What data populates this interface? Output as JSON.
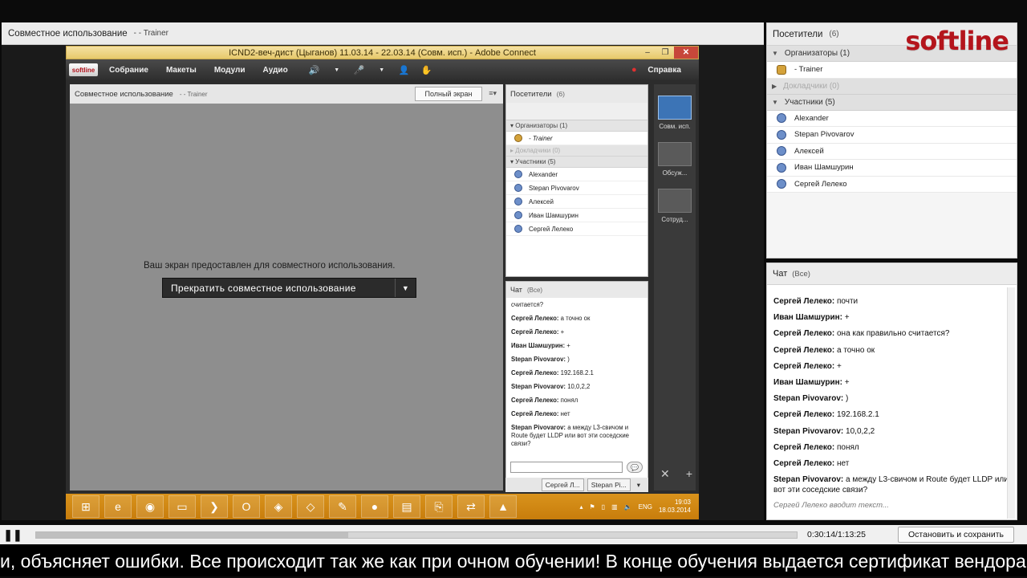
{
  "share": {
    "title": "Совместное использование",
    "presenter": "- - Trainer"
  },
  "inner": {
    "window_title": "ICND2-веч-дист (Цыганов) 11.03.14 - 22.03.14 (Совм. исп.) - Adobe Connect",
    "logo": "softline",
    "menu": [
      "Собрание",
      "Макеты",
      "Модули",
      "Аудио"
    ],
    "help": "Справка",
    "share_title": "Совместное использование",
    "share_presenter": "- - Trainer",
    "fullscreen_label": "Полный экран",
    "share_message": "Ваш экран предоставлен для совместного использования.",
    "stop_share_label": "Прекратить совместное использование",
    "attendees": {
      "title": "Посетители",
      "count": "(6)",
      "hosts_label": "Организаторы (1)",
      "hosts": [
        "- Trainer"
      ],
      "presenters_label": "Докладчики (0)",
      "participants_label": "Участники (5)",
      "participants": [
        "Alexander",
        "Stepan Pivovarov",
        "Алексей",
        "Иван Шамшурин",
        "Сергей Лелеко"
      ]
    },
    "chat": {
      "title": "Чат",
      "scope": "(Все)",
      "lead": "считается?",
      "messages": [
        {
          "author": "Сергей Лелеко:",
          "text": "а точно ок"
        },
        {
          "author": "Сергей Лелеко:",
          "text": "+"
        },
        {
          "author": "Иван Шамшурин:",
          "text": "+"
        },
        {
          "author": "Stepan Pivovarov:",
          "text": ")"
        },
        {
          "author": "Сергей Лелеко:",
          "text": "192.168.2.1"
        },
        {
          "author": "Stepan Pivovarov:",
          "text": "10,0,2,2"
        },
        {
          "author": "Сергей Лелеко:",
          "text": "понял"
        },
        {
          "author": "Сергей Лелеко:",
          "text": "нет"
        },
        {
          "author": "Stepan Pivovarov:",
          "text": "а между L3-свичом и Route будет LLDP или вот эти соседские связи?"
        }
      ],
      "tabs": [
        "Сергей Л...",
        "Stepan Pi..."
      ]
    },
    "layouts": [
      "Совм. исп.",
      "Обсуж...",
      "Сотруд..."
    ],
    "taskbar": {
      "lang": "ENG",
      "time": "19:03",
      "date": "18.03.2014"
    }
  },
  "attendees": {
    "title": "Посетители",
    "count": "(6)",
    "hosts_label": "Организаторы (1)",
    "hosts": [
      "- Trainer"
    ],
    "presenters_label": "Докладчики (0)",
    "participants_label": "Участники (5)",
    "participants": [
      "Alexander",
      "Stepan Pivovarov",
      "Алексей",
      "Иван Шамшурин",
      "Сергей Лелеко"
    ]
  },
  "brand": {
    "logo": "softline",
    "color": "#b4151c"
  },
  "chat": {
    "title": "Чат",
    "scope": "(Все)",
    "messages": [
      {
        "author": "Сергей Лелеко:",
        "text": "почти"
      },
      {
        "author": "Иван Шамшурин:",
        "text": "+"
      },
      {
        "author": "Сергей Лелеко:",
        "text": "она как правильно считается?"
      },
      {
        "author": "Сергей Лелеко:",
        "text": "а точно ок"
      },
      {
        "author": "Сергей Лелеко:",
        "text": "+"
      },
      {
        "author": "Иван Шамшурин:",
        "text": "+"
      },
      {
        "author": "Stepan Pivovarov:",
        "text": ")"
      },
      {
        "author": "Сергей Лелеко:",
        "text": "192.168.2.1"
      },
      {
        "author": "Stepan Pivovarov:",
        "text": "10,0,2,2"
      },
      {
        "author": "Сергей Лелеко:",
        "text": "понял"
      },
      {
        "author": "Сергей Лелеко:",
        "text": "нет"
      },
      {
        "author": "Stepan Pivovarov:",
        "text": "а между L3-свичом и Route будет LLDP или вот эти соседские связи?"
      }
    ],
    "typing": "Сергей Лелеко вводит текст..."
  },
  "player": {
    "time": "0:30:14/1:13:25",
    "progress": 0.41,
    "stop_save_label": "Остановить и сохранить"
  },
  "ticker": "и, объясняет ошибки. Все происходит так же как при очном обучении! В конце обучения выдается сертификат вендора"
}
